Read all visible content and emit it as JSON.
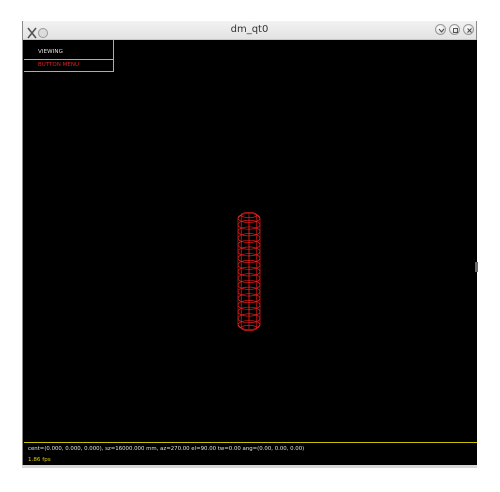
{
  "window": {
    "title": "dm_qt0"
  },
  "menu": {
    "title": "VIEWING",
    "items": [
      "BUTTON MENU"
    ],
    "border_color": "#c9c000",
    "title_color": "#e8e8e8",
    "item_color": "#e02020"
  },
  "scene": {
    "object": "wireframe cylinder",
    "wire_color": "#ff2020",
    "background": "#000000"
  },
  "status": {
    "line": "cent=(0.000, 0.000, 0.000), sz=16000.000 mm, az=270.00 el=90.00 tw=0.00 ang=(0.00, 0.00, 0.00)",
    "fps": "1.86 fps"
  },
  "icons": {
    "app": "x-app-icon",
    "minimize": "chevron-down-icon",
    "restore": "restore-icon",
    "close": "close-icon"
  }
}
